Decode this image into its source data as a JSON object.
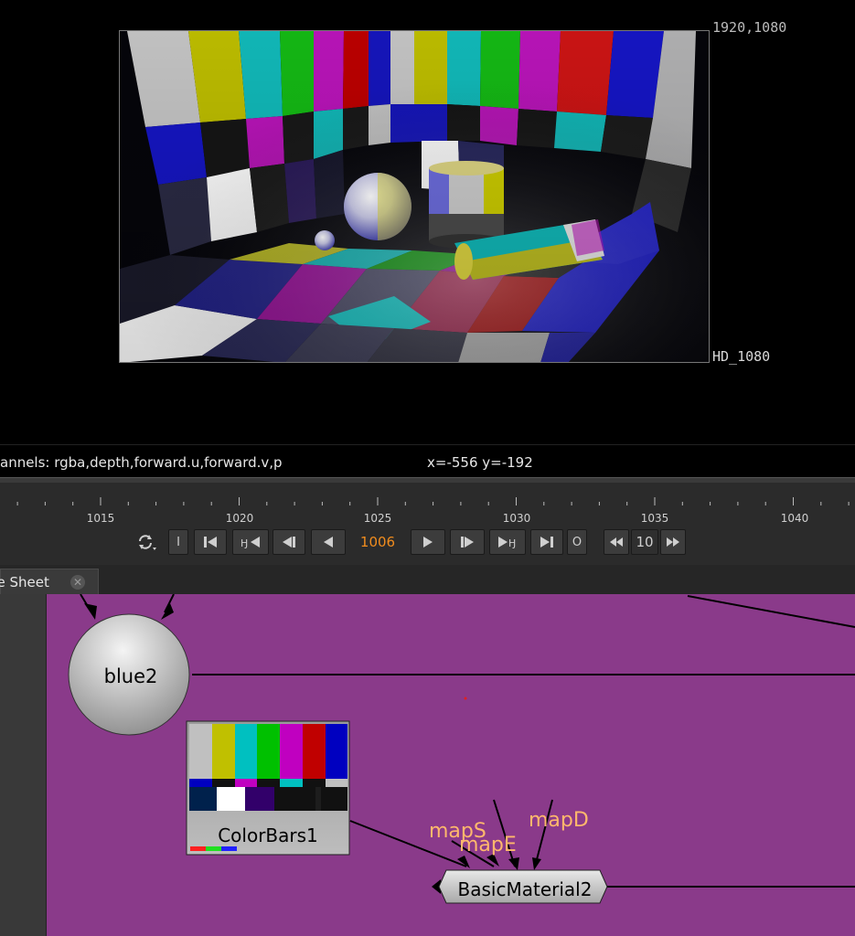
{
  "viewer": {
    "format_size": "1920,1080",
    "format_name": "HD_1080"
  },
  "info_bar": {
    "channels": "annels: rgba,depth,forward.u,forward.v,p",
    "coords": "x=-556 y=-192"
  },
  "timeline": {
    "tick_labels": [
      "1015",
      "1020",
      "1025",
      "1030",
      "1035",
      "1040"
    ],
    "current_frame": "1006",
    "step_value": "10",
    "buttons": {
      "in_label": "I",
      "out_label": "O"
    }
  },
  "tabs": {
    "dope_sheet_label": "pe Sheet"
  },
  "nodegraph": {
    "background_color": "#8a3a8a",
    "nodes": {
      "blue2": "blue2",
      "colorbars": "ColorBars1",
      "material": "BasicMaterial2"
    },
    "input_labels": {
      "maps": "mapS",
      "mape": "mapE",
      "mapd": "mapD"
    }
  },
  "icons": [
    "sync-icon",
    "first-frame-icon",
    "prev-keyframe-icon",
    "prev-frame-icon",
    "play-backward-icon",
    "play-forward-icon",
    "next-frame-icon",
    "next-keyframe-icon",
    "last-frame-icon",
    "step-back-icon",
    "step-forward-icon",
    "close-icon"
  ]
}
